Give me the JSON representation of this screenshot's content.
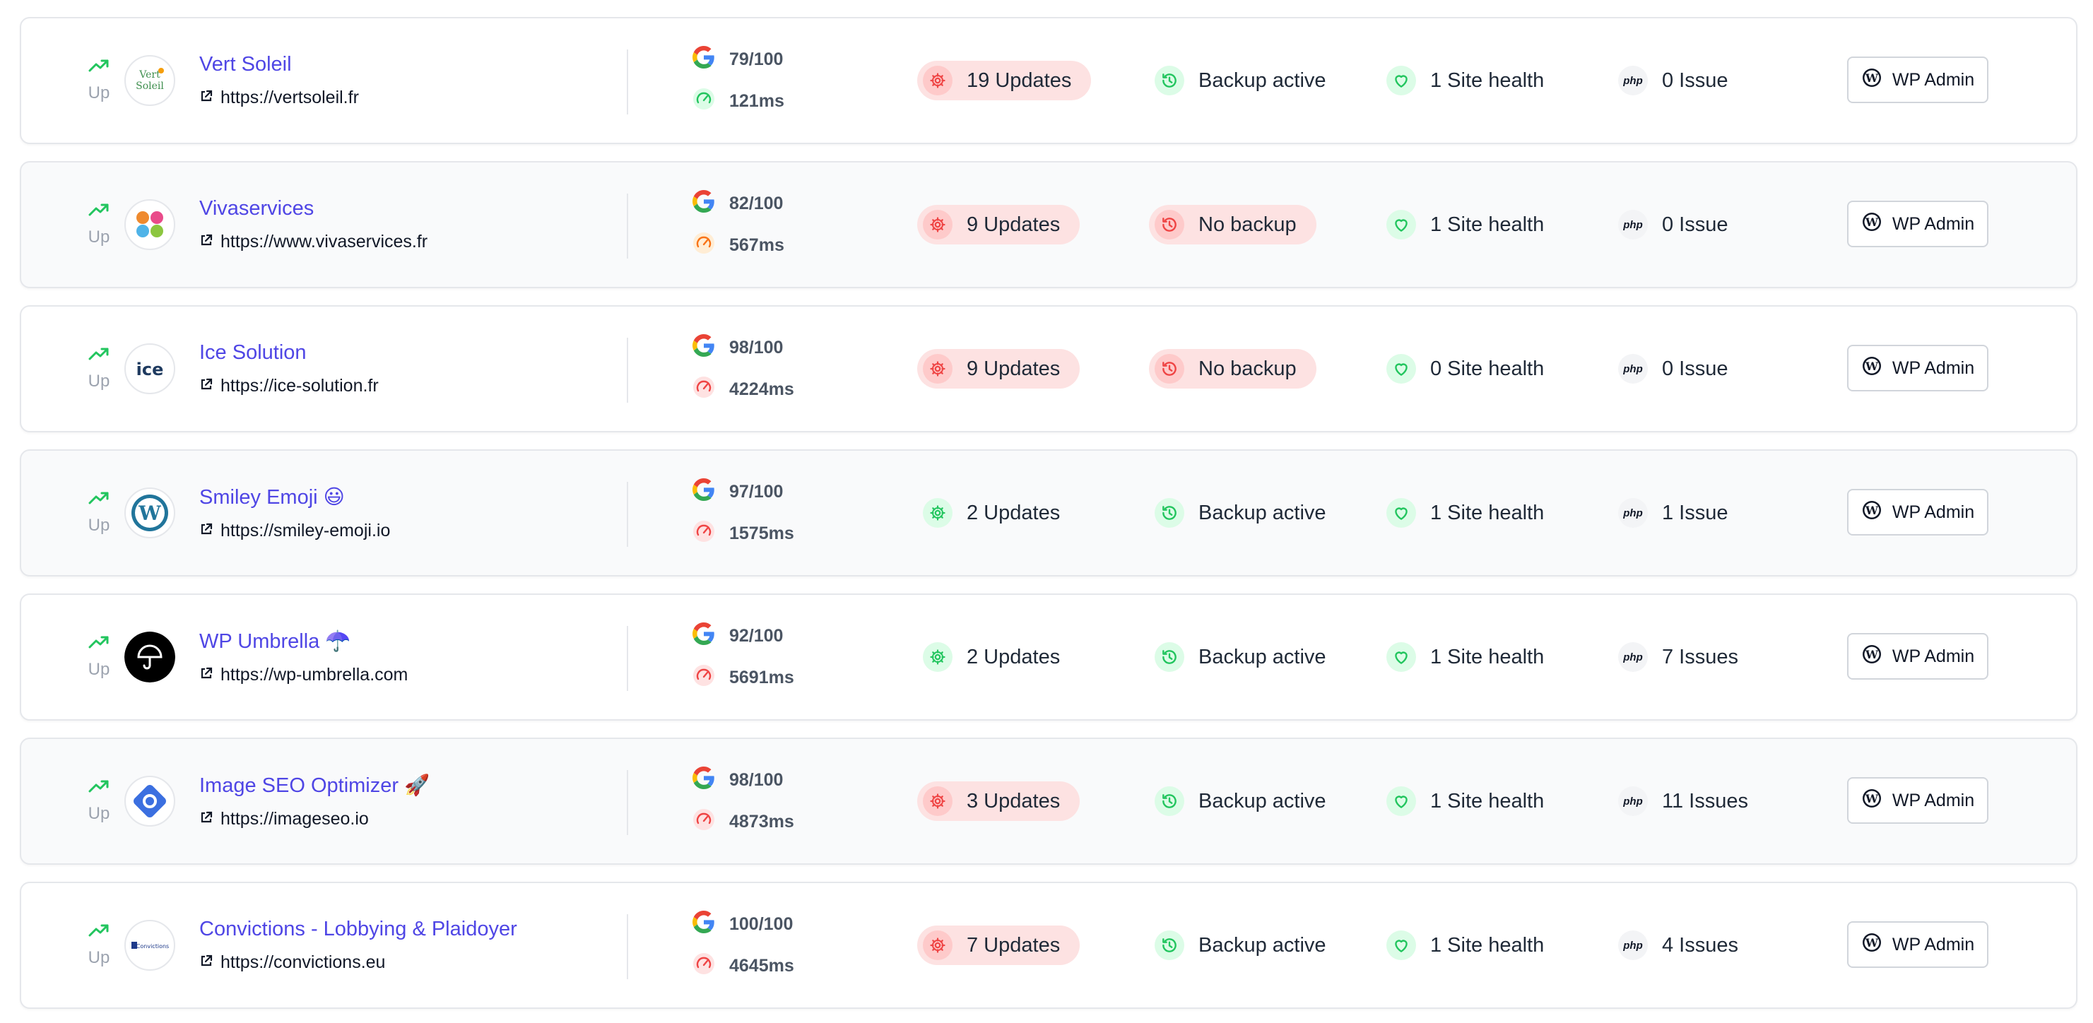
{
  "colors": {
    "accent": "#4f46e5",
    "up": "#22c55e",
    "bad_bg": "#fde2e2",
    "bad_icon": "#ef4444",
    "good_icon": "#22c55e",
    "speed_warn": "#f97316"
  },
  "sites": [
    {
      "status": "Up",
      "name": "Vert Soleil",
      "url": "https://vertsoleil.fr",
      "logo": "vert-soleil-logo",
      "logo_text": "Vert Soleil",
      "score": "79/100",
      "speed": "121ms",
      "speed_level": "good",
      "updates": "19 Updates",
      "updates_state": "bad",
      "backup": "Backup active",
      "backup_state": "good",
      "health": "1 Site health",
      "php": "0 Issue",
      "admin": "WP Admin"
    },
    {
      "status": "Up",
      "name": "Vivaservices",
      "url": "https://www.vivaservices.fr",
      "logo": "vivaservices-logo",
      "logo_text": "",
      "score": "82/100",
      "speed": "567ms",
      "speed_level": "warn",
      "updates": "9 Updates",
      "updates_state": "bad",
      "backup": "No backup",
      "backup_state": "bad",
      "health": "1 Site health",
      "php": "0 Issue",
      "admin": "WP Admin"
    },
    {
      "status": "Up",
      "name": "Ice Solution",
      "url": "https://ice-solution.fr",
      "logo": "ice-solution-logo",
      "logo_text": "ICE",
      "score": "98/100",
      "speed": "4224ms",
      "speed_level": "bad",
      "updates": "9 Updates",
      "updates_state": "bad",
      "backup": "No backup",
      "backup_state": "bad",
      "health": "0 Site health",
      "php": "0 Issue",
      "admin": "WP Admin"
    },
    {
      "status": "Up",
      "name": "Smiley Emoji 😃",
      "url": "https://smiley-emoji.io",
      "logo": "wordpress-logo",
      "logo_text": "",
      "score": "97/100",
      "speed": "1575ms",
      "speed_level": "bad",
      "updates": "2 Updates",
      "updates_state": "good",
      "backup": "Backup active",
      "backup_state": "good",
      "health": "1 Site health",
      "php": "1 Issue",
      "admin": "WP Admin"
    },
    {
      "status": "Up",
      "name": "WP Umbrella ☂️",
      "url": "https://wp-umbrella.com",
      "logo": "wp-umbrella-logo",
      "logo_text": "",
      "score": "92/100",
      "speed": "5691ms",
      "speed_level": "bad",
      "updates": "2 Updates",
      "updates_state": "good",
      "backup": "Backup active",
      "backup_state": "good",
      "health": "1 Site health",
      "php": "7 Issues",
      "admin": "WP Admin"
    },
    {
      "status": "Up",
      "name": "Image SEO Optimizer 🚀",
      "url": "https://imageseo.io",
      "logo": "imageseo-logo",
      "logo_text": "",
      "score": "98/100",
      "speed": "4873ms",
      "speed_level": "bad",
      "updates": "3 Updates",
      "updates_state": "bad",
      "backup": "Backup active",
      "backup_state": "good",
      "health": "1 Site health",
      "php": "11 Issues",
      "admin": "WP Admin"
    },
    {
      "status": "Up",
      "name": "Convictions - Lobbying & Plaidoyer",
      "url": "https://convictions.eu",
      "logo": "convictions-logo",
      "logo_text": "Convictions",
      "score": "100/100",
      "speed": "4645ms",
      "speed_level": "bad",
      "updates": "7 Updates",
      "updates_state": "bad",
      "backup": "Backup active",
      "backup_state": "good",
      "health": "1 Site health",
      "php": "4 Issues",
      "admin": "WP Admin"
    }
  ],
  "php_label": "php"
}
